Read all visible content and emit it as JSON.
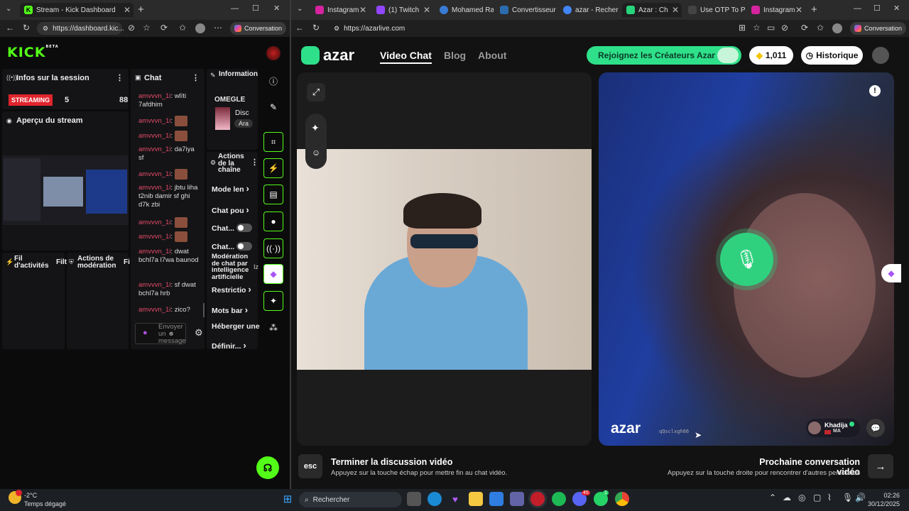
{
  "left_browser": {
    "tab_title": "Stream - Kick Dashboard",
    "url": "https://dashboard.kic...",
    "conversation": "Conversation"
  },
  "kick": {
    "logo": "KICK",
    "logo_beta": "BETA",
    "session_title": "Infos sur la session",
    "streaming_badge": "STREAMING",
    "viewers": "5",
    "followers": "88",
    "preview_title": "Aperçu du stream",
    "activity_title": "Fil d'activités",
    "activity_filter": "Filt",
    "moderation_title": "Actions de modération",
    "moderation_filter": "Fi",
    "chat_title": "Chat",
    "chat_messages": [
      {
        "user": "amvvvn_1i",
        "text": ": wlïti 7afdhim"
      },
      {
        "user": "amvvvn_1i",
        "text": ":"
      },
      {
        "user": "amvvvn_1i",
        "text": ":"
      },
      {
        "user": "amvvvn_1i",
        "text": ": da7iya sf"
      },
      {
        "user": "amvvvn_1i",
        "text": ":"
      },
      {
        "user": "amvvvn_1i",
        "text": ": jbtu liha t2nib damir sf ghi d7k zbi"
      },
      {
        "user": "amvvvn_1i",
        "text": ":"
      },
      {
        "user": "amvvvn_1i",
        "text": ":"
      },
      {
        "user": "amvvvn_1i",
        "text": ": dwat bchl7a l7wa baunod"
      },
      {
        "user": "amvvvn_1i",
        "text": ": sf dwat bchl7a hrb"
      },
      {
        "user": "amvvvn_1i",
        "text": ": zico?"
      }
    ],
    "chat_placeholder": "Envoyer un ☻ message",
    "stream_info_title": "Informations sur le stream",
    "stream_category": "OMEGLE",
    "stream_disc": "Disc",
    "stream_tag": "Ara",
    "channel_actions_title": "Actions de la chaîne",
    "actions": [
      {
        "label": "Mode len"
      },
      {
        "label": "Chat pou"
      },
      {
        "label": "Chat..."
      },
      {
        "label": "Chat..."
      },
      {
        "label": "Modération de chat par intelligence artificielle"
      },
      {
        "label": "Restrictio"
      },
      {
        "label": "Mots bar"
      },
      {
        "label": "Héberger une"
      },
      {
        "label": "Définir..."
      }
    ],
    "ai_suffix": "Iz"
  },
  "right_browser": {
    "tabs": [
      {
        "title": "Instagram",
        "color": "#d6249f"
      },
      {
        "title": "(1) Twitch",
        "color": "#9146ff"
      },
      {
        "title": "Mohamed Ra",
        "color": "#3a7bd5"
      },
      {
        "title": "Convertisseur",
        "color": "#2b6cb0"
      },
      {
        "title": "azar - Recher",
        "color": "#4285f4"
      },
      {
        "title": "Azar : Ch",
        "color": "#27d47c"
      },
      {
        "title": "Use OTP To P",
        "color": "#444444"
      },
      {
        "title": "Instagram",
        "color": "#d6249f"
      }
    ],
    "url": "https://azarlive.com",
    "conversation": "Conversation"
  },
  "azar": {
    "logo": "azar",
    "nav": [
      "Video Chat",
      "Blog",
      "About"
    ],
    "creators_button": "Rejoignez les Créateurs Azar",
    "gems": "1,011",
    "history": "Historique",
    "watermark": "azar",
    "watermark_id": "qQsclxgh66",
    "partner_name": "Khadija",
    "partner_country": "MA",
    "end_key": "esc",
    "end_title": "Terminer la discussion vidéo",
    "end_sub": "Appuyez sur la touche échap pour mettre fin au chat vidéo.",
    "next_title": "Prochaine conversation vidéo",
    "next_sub": "Appuyez sur la touche droite pour rencontrer d'autres personnes"
  },
  "taskbar": {
    "temp": "-2°C",
    "weather": "Temps dégagé",
    "search": "Rechercher",
    "time": "02:26",
    "date": "30/12/2025",
    "badge_discord": "45",
    "badge_whatsapp": "1"
  },
  "colors": {
    "kick_green": "#53fc18",
    "azar_green": "#2fe08a",
    "streaming_red": "#e0242d"
  }
}
